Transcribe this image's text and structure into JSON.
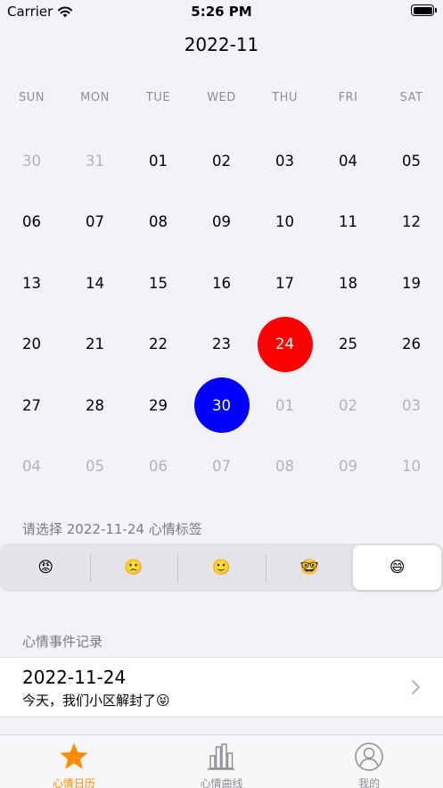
{
  "status_bar": {
    "carrier": "Carrier",
    "time": "5:26 PM"
  },
  "calendar": {
    "title": "2022-11",
    "weekdays": [
      "SUN",
      "MON",
      "TUE",
      "WED",
      "THU",
      "FRI",
      "SAT"
    ],
    "days": [
      {
        "label": "30",
        "state": "muted"
      },
      {
        "label": "31",
        "state": "muted"
      },
      {
        "label": "01",
        "state": "normal"
      },
      {
        "label": "02",
        "state": "normal"
      },
      {
        "label": "03",
        "state": "normal"
      },
      {
        "label": "04",
        "state": "normal"
      },
      {
        "label": "05",
        "state": "normal"
      },
      {
        "label": "06",
        "state": "normal"
      },
      {
        "label": "07",
        "state": "normal"
      },
      {
        "label": "08",
        "state": "normal"
      },
      {
        "label": "09",
        "state": "normal"
      },
      {
        "label": "10",
        "state": "normal"
      },
      {
        "label": "11",
        "state": "normal"
      },
      {
        "label": "12",
        "state": "normal"
      },
      {
        "label": "13",
        "state": "normal"
      },
      {
        "label": "14",
        "state": "normal"
      },
      {
        "label": "15",
        "state": "normal"
      },
      {
        "label": "16",
        "state": "normal"
      },
      {
        "label": "17",
        "state": "normal"
      },
      {
        "label": "18",
        "state": "normal"
      },
      {
        "label": "19",
        "state": "normal"
      },
      {
        "label": "20",
        "state": "normal"
      },
      {
        "label": "21",
        "state": "normal"
      },
      {
        "label": "22",
        "state": "normal"
      },
      {
        "label": "23",
        "state": "normal"
      },
      {
        "label": "24",
        "state": "red"
      },
      {
        "label": "25",
        "state": "normal"
      },
      {
        "label": "26",
        "state": "normal"
      },
      {
        "label": "27",
        "state": "normal"
      },
      {
        "label": "28",
        "state": "normal"
      },
      {
        "label": "29",
        "state": "normal"
      },
      {
        "label": "30",
        "state": "blue"
      },
      {
        "label": "01",
        "state": "muted"
      },
      {
        "label": "02",
        "state": "muted"
      },
      {
        "label": "03",
        "state": "muted"
      },
      {
        "label": "04",
        "state": "muted"
      },
      {
        "label": "05",
        "state": "muted"
      },
      {
        "label": "06",
        "state": "muted"
      },
      {
        "label": "07",
        "state": "muted"
      },
      {
        "label": "08",
        "state": "muted"
      },
      {
        "label": "09",
        "state": "muted"
      },
      {
        "label": "10",
        "state": "muted"
      }
    ]
  },
  "mood_section": {
    "label": "请选择 2022-11-24 心情标签",
    "options": [
      {
        "emoji": "😡",
        "name": "angry"
      },
      {
        "emoji": "🙁",
        "name": "sad"
      },
      {
        "emoji": "🙂",
        "name": "calm"
      },
      {
        "emoji": "🤓",
        "name": "nerd"
      },
      {
        "emoji": "😄",
        "name": "happy"
      }
    ],
    "selected_index": 4
  },
  "records": {
    "label": "心情事件记录",
    "items": [
      {
        "date": "2022-11-24",
        "text": "今天，我们小区解封了😝"
      }
    ]
  },
  "tabs": [
    {
      "label": "心情日历",
      "icon": "star-icon",
      "active": true
    },
    {
      "label": "心情曲线",
      "icon": "bar-chart-icon",
      "active": false
    },
    {
      "label": "我的",
      "icon": "person-icon",
      "active": false
    }
  ],
  "colors": {
    "accent": "#ff8c00",
    "selected_day": "#ff0000",
    "today": "#0000ff",
    "background": "#f2f2f7"
  }
}
